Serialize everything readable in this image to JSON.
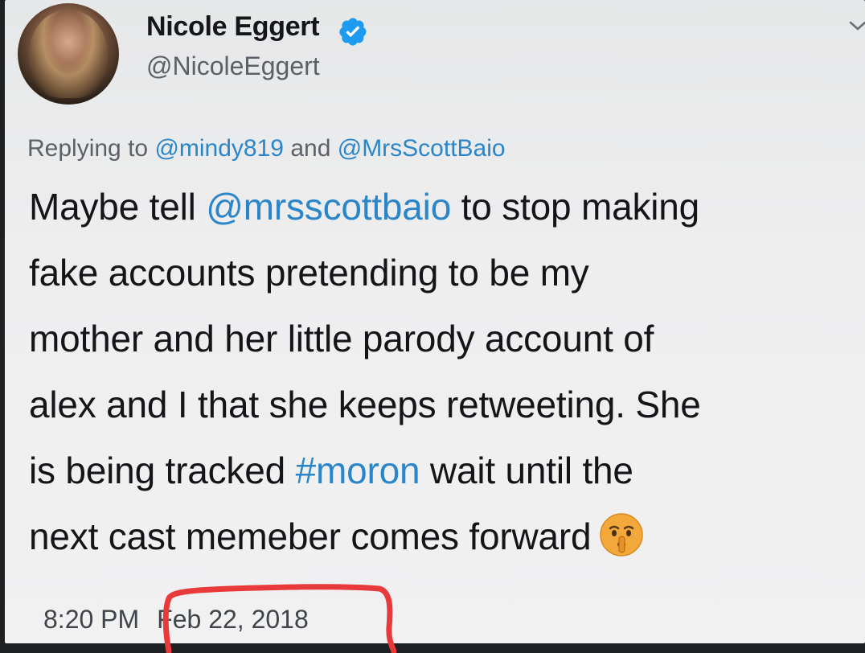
{
  "tweet": {
    "author_name": "Nicole Eggert",
    "author_handle": "@NicoleEggert",
    "reply_prefix": "Replying to",
    "reply_to": [
      "@mindy819",
      "@MrsScottBaio"
    ],
    "reply_joiner": "and",
    "text_segments": {
      "l1a": "Maybe tell ",
      "l1b": "@mrsscottbaio",
      "l1c": " to stop making",
      "l2": "fake accounts pretending to be my",
      "l3": "mother and her little parody account of",
      "l4": "alex and I that she keeps retweeting. She",
      "l5a": "is being tracked ",
      "l5b": "#moron",
      "l5c": " wait until the",
      "l6": "next cast memeber comes forward"
    },
    "emoji": "shushing-face-icon",
    "time": "8:20 PM",
    "date": "Feb 22, 2018"
  },
  "colors": {
    "link": "#2a86c9",
    "verified": "#1d9bf0",
    "annotation": "#e83a3a"
  }
}
